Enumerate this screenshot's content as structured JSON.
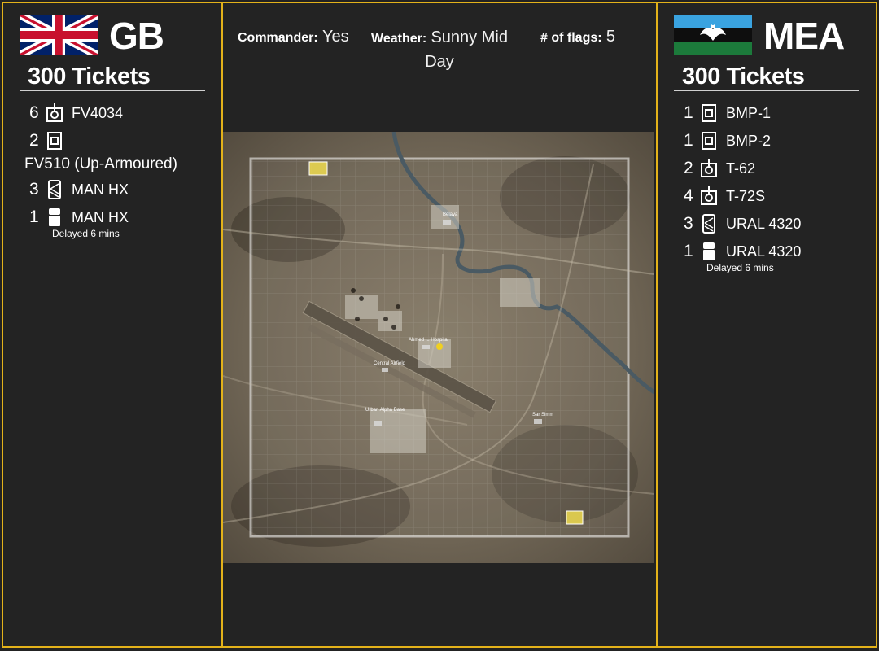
{
  "teams": {
    "left": {
      "name": "GB",
      "tickets": "300 Tickets",
      "flag_icon": "uk-flag-icon",
      "units": [
        {
          "count": "6",
          "icon": "tank-icon",
          "name": "FV4034"
        },
        {
          "count": "2",
          "icon": "apc-icon",
          "name": "",
          "name_below": "FV510 (Up-Armoured)"
        },
        {
          "count": "3",
          "icon": "logistics-truck-icon",
          "name": "MAN HX"
        },
        {
          "count": "1",
          "icon": "transport-truck-icon",
          "name": "MAN HX",
          "note": "Delayed 6 mins"
        }
      ]
    },
    "right": {
      "name": "MEA",
      "tickets": "300 Tickets",
      "flag_icon": "mea-flag-icon",
      "units": [
        {
          "count": "1",
          "icon": "apc-icon",
          "name": "BMP-1"
        },
        {
          "count": "1",
          "icon": "apc-icon",
          "name": "BMP-2"
        },
        {
          "count": "2",
          "icon": "tank-icon",
          "name": "T-62"
        },
        {
          "count": "4",
          "icon": "tank-icon",
          "name": "T-72S"
        },
        {
          "count": "3",
          "icon": "logistics-truck-icon",
          "name": "URAL 4320"
        },
        {
          "count": "1",
          "icon": "transport-truck-icon",
          "name": "URAL 4320",
          "note": "Delayed 6 mins"
        }
      ]
    }
  },
  "info": {
    "commander_label": "Commander:",
    "commander_value": "Yes",
    "weather_label": "Weather:",
    "weather_value": "Sunny Mid Day",
    "flags_label": "# of flags:",
    "flags_value": "5"
  },
  "map": {
    "labels": [
      "Central Airfield",
      "Ahmed ... Hospital",
      "Belaya",
      "Urban Alpha Base",
      "Sar Simm"
    ],
    "border_color": "#e3b21a",
    "background_color": "#222222"
  }
}
